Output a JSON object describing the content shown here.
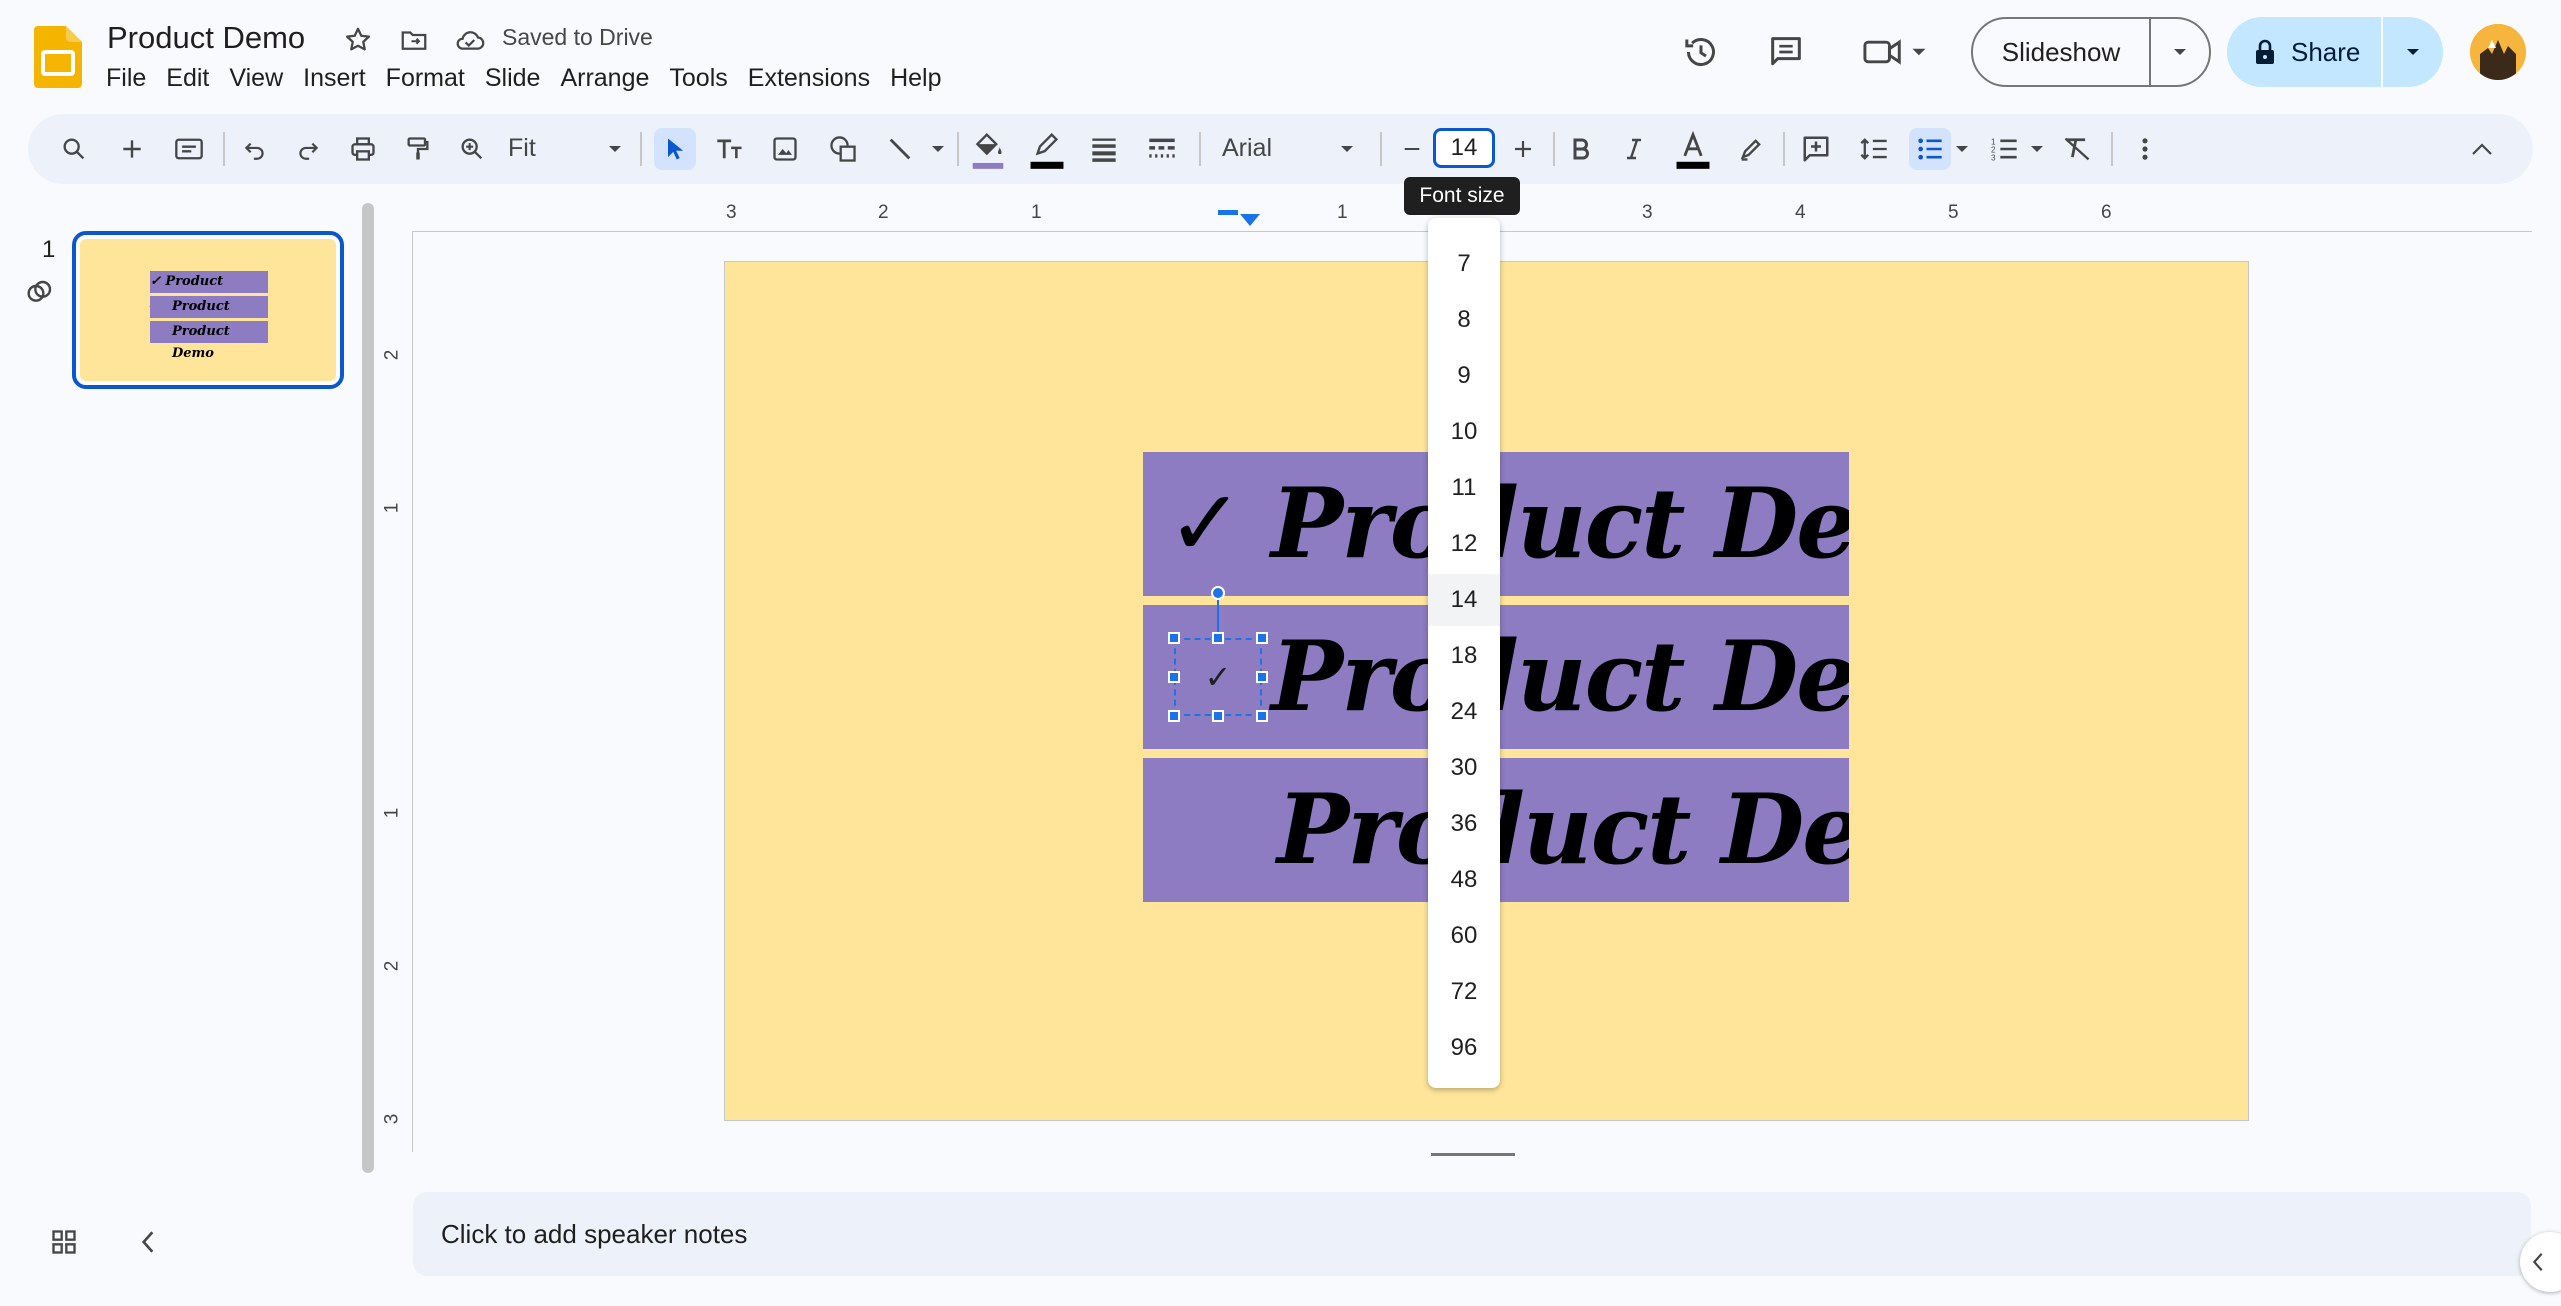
{
  "app": {
    "doc_title": "Product Demo",
    "saved_status": "Saved to Drive",
    "menu": [
      "File",
      "Edit",
      "View",
      "Insert",
      "Format",
      "Slide",
      "Arrange",
      "Tools",
      "Extensions",
      "Help"
    ],
    "slideshow_label": "Slideshow",
    "share_label": "Share"
  },
  "toolbar": {
    "zoom_label": "Fit",
    "font_name": "Arial",
    "font_size": "14",
    "tooltip": "Font size"
  },
  "font_size_menu": {
    "options": [
      "7",
      "8",
      "9",
      "10",
      "11",
      "12",
      "14",
      "18",
      "24",
      "30",
      "36",
      "48",
      "60",
      "72",
      "96"
    ],
    "selected": "14"
  },
  "rulers": {
    "horizontal": [
      "3",
      "2",
      "1",
      "1",
      "3",
      "4",
      "5",
      "6"
    ],
    "vertical": [
      "2",
      "1",
      "1",
      "2",
      "3"
    ]
  },
  "filmstrip": {
    "slide_number": "1",
    "thumb_texts": [
      "✓ Product Demo",
      "Product Demo",
      "Product Demo"
    ]
  },
  "slide": {
    "rows": [
      {
        "prefix": "✓",
        "text": "Product Demo"
      },
      {
        "prefix": "✓",
        "text": "Product Demo"
      },
      {
        "prefix": "",
        "text": "Product Demo"
      }
    ],
    "background": "#ffe599",
    "bar_color": "#8e7cc3"
  },
  "notes": {
    "placeholder": "Click to add speaker notes"
  },
  "colors": {
    "accent": "#0b57d0",
    "share_bg": "#c2e7ff",
    "fill_swatch": "#8e7cc3",
    "text_swatch": "#000000"
  },
  "icons": [
    "slides-logo-icon",
    "star-icon",
    "move-folder-icon",
    "cloud-saved-icon",
    "history-icon",
    "comment-icon",
    "meet-icon",
    "lock-icon",
    "search-icon",
    "plus-icon",
    "new-slide-icon",
    "undo-icon",
    "redo-icon",
    "print-icon",
    "paint-format-icon",
    "zoom-icon",
    "select-icon",
    "textbox-icon",
    "image-icon",
    "shape-icon",
    "line-icon",
    "fill-color-icon",
    "border-color-icon",
    "border-weight-icon",
    "border-dash-icon",
    "minus-icon",
    "bold-icon",
    "italic-icon",
    "text-color-icon",
    "highlight-icon",
    "insert-comment-icon",
    "line-spacing-icon",
    "bulleted-list-icon",
    "numbered-list-icon",
    "clear-formatting-icon",
    "more-icon",
    "collapse-icon",
    "grid-view-icon",
    "chevron-left-icon"
  ]
}
